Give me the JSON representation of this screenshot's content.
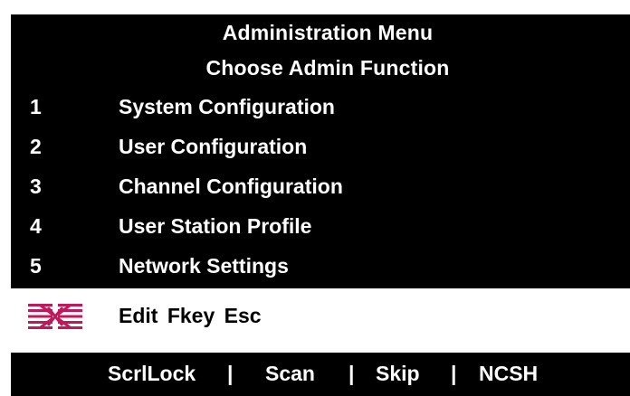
{
  "header": {
    "title": "Administration Menu",
    "subtitle": "Choose Admin Function"
  },
  "menu": {
    "items": [
      {
        "number": "1",
        "label": "System Configuration"
      },
      {
        "number": "2",
        "label": "User Configuration"
      },
      {
        "number": "3",
        "label": "Channel Configuration"
      },
      {
        "number": "4",
        "label": "User Station Profile"
      },
      {
        "number": "5",
        "label": "Network Settings"
      }
    ]
  },
  "command_line": {
    "logo_icon": "switch-logo-icon",
    "text": "Edit Fkey Esc"
  },
  "bottom_bar": {
    "scrllock": "ScrlLock",
    "scan": "Scan",
    "skip": "Skip",
    "ncsh": "NCSH",
    "separator": "|"
  },
  "colors": {
    "panel_background": "#000000",
    "panel_text": "#ffffff",
    "command_background": "#ffffff",
    "logo_accent": "#c0185a"
  }
}
